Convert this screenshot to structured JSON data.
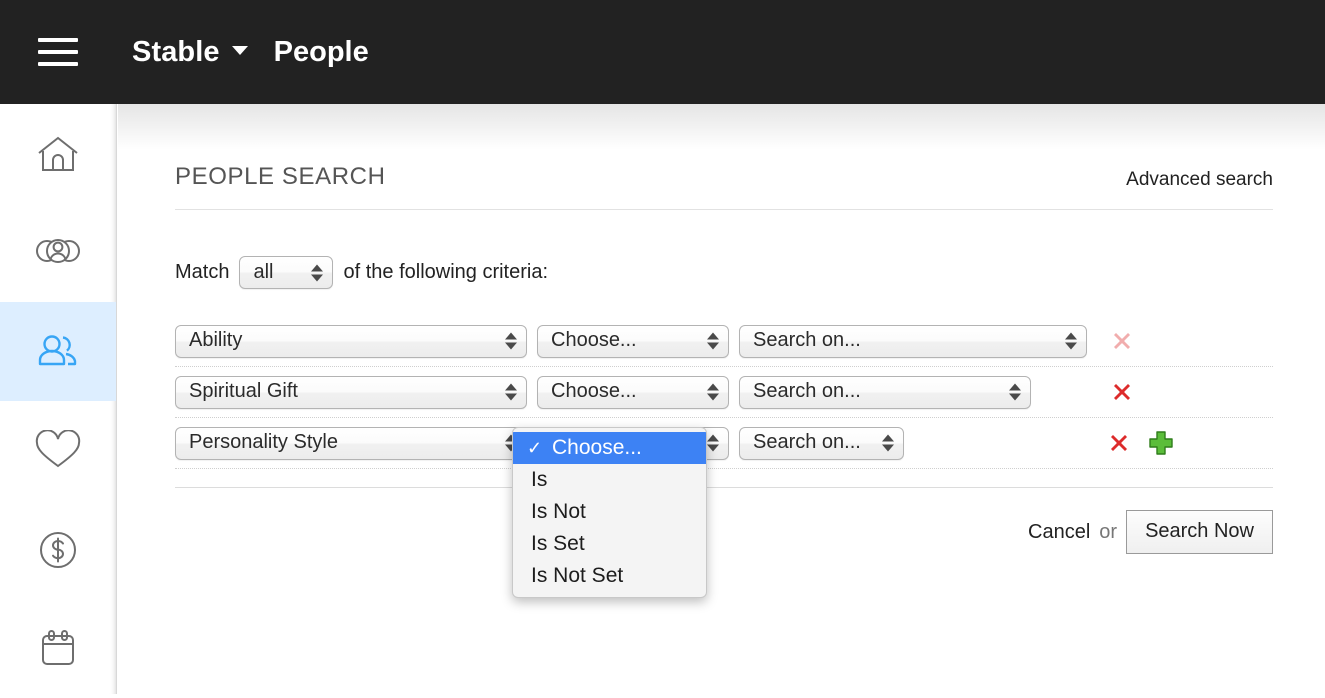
{
  "header": {
    "menu_icon": "hamburger-icon",
    "brand": "Stable",
    "brand_caret": "caret-down-icon",
    "section": "People"
  },
  "sidebar": {
    "items": [
      {
        "name": "home",
        "icon": "home-icon",
        "active": false
      },
      {
        "name": "groups",
        "icon": "groups-icon",
        "active": false
      },
      {
        "name": "people",
        "icon": "people-icon",
        "active": true
      },
      {
        "name": "favorites",
        "icon": "heart-icon",
        "active": false
      },
      {
        "name": "giving",
        "icon": "dollar-icon",
        "active": false
      },
      {
        "name": "calendar",
        "icon": "calendar-icon",
        "active": false
      }
    ],
    "active_color": "#37a5f5",
    "active_bg": "#ddeeff",
    "idle_color": "#6e6e6e"
  },
  "panel": {
    "title": "PEOPLE SEARCH",
    "advanced_link": "Advanced search",
    "match_prefix": "Match",
    "match_value": "all",
    "match_suffix": "of the following criteria:"
  },
  "criteria": [
    {
      "field": "Ability",
      "operator": "Choose...",
      "value": "Search on...",
      "remove_icon": "remove-x-icon",
      "remove_faded": true,
      "add_icon": null
    },
    {
      "field": "Spiritual Gift",
      "operator": "Choose...",
      "value": "Search on...",
      "remove_icon": "remove-x-icon",
      "remove_faded": false,
      "add_icon": null
    },
    {
      "field": "Personality Style",
      "operator": "Choose...",
      "value": "Search on...",
      "remove_icon": "remove-x-icon",
      "remove_faded": false,
      "add_icon": "add-plus-icon"
    }
  ],
  "dropdown": {
    "open_for_row": 3,
    "check_glyph": "✓",
    "options": [
      {
        "label": "Choose...",
        "selected": true
      },
      {
        "label": "Is",
        "selected": false
      },
      {
        "label": "Is Not",
        "selected": false
      },
      {
        "label": "Is Set",
        "selected": false
      },
      {
        "label": "Is Not Set",
        "selected": false
      }
    ],
    "highlight_color": "#3d82f4"
  },
  "footer": {
    "cancel": "Cancel",
    "or": "or",
    "search_button": "Search Now"
  }
}
